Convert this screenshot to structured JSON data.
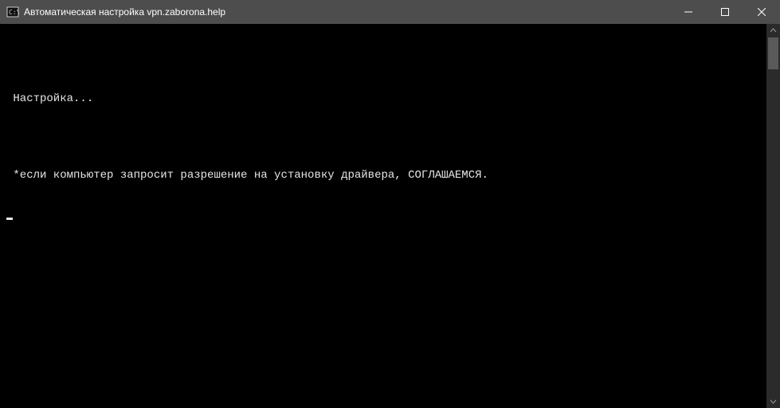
{
  "window": {
    "title": "Автоматическая настройка vpn.zaborona.help"
  },
  "console": {
    "lines": [
      "",
      " Настройка...",
      "",
      " *если компьютер запросит разрешение на установку драйвера, СОГЛАШАЕМСЯ.",
      ""
    ]
  }
}
